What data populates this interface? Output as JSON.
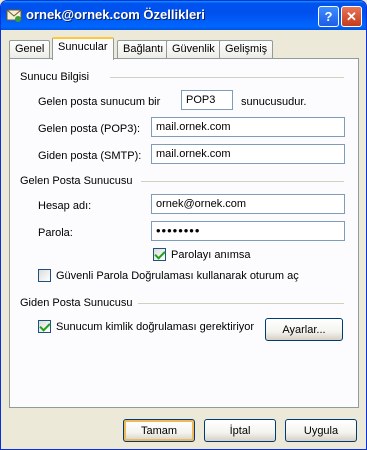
{
  "window": {
    "title": "ornek@ornek.com Özellikleri"
  },
  "titlebar_buttons": {
    "help": "?",
    "close": "✕"
  },
  "tabs": [
    "Genel",
    "Sunucular",
    "Bağlantı",
    "Güvenlik",
    "Gelişmiş"
  ],
  "active_tab": "Sunucular",
  "server_info": {
    "heading": "Sunucu Bilgisi",
    "incoming_prefix": "Gelen posta sunucum bir",
    "incoming_type": "POP3",
    "incoming_suffix": "sunucusudur.",
    "incoming_label": "Gelen posta (POP3):",
    "incoming_value": "mail.ornek.com",
    "outgoing_label": "Giden posta (SMTP):",
    "outgoing_value": "mail.ornek.com"
  },
  "incoming_server": {
    "heading": "Gelen Posta Sunucusu",
    "account_label": "Hesap adı:",
    "account_value": "ornek@ornek.com",
    "password_label": "Parola:",
    "password_value": "••••••••",
    "remember_label": "Parolayı anımsa",
    "remember_checked": true,
    "spa_label": "Güvenli Parola Doğrulaması kullanarak oturum aç",
    "spa_checked": false
  },
  "outgoing_server": {
    "heading": "Giden Posta Sunucusu",
    "auth_label": "Sunucum kimlik doğrulaması gerektiriyor",
    "auth_checked": true,
    "settings_button": "Ayarlar..."
  },
  "footer": {
    "ok": "Tamam",
    "cancel": "İptal",
    "apply": "Uygula"
  }
}
